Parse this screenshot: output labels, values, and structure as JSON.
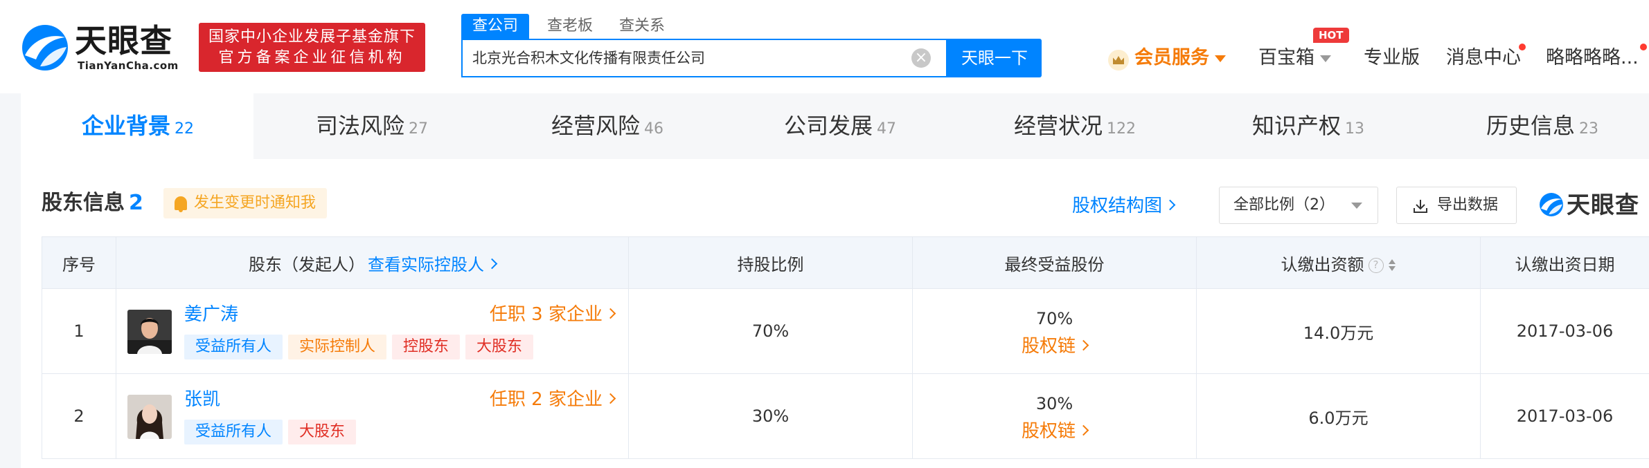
{
  "header": {
    "logo_cn": "天眼查",
    "logo_en": "TianYanCha.com",
    "badge_line1": "国家中小企业发展子基金旗下",
    "badge_line2": "官方备案企业征信机构",
    "search_tabs": [
      "查公司",
      "查老板",
      "查关系"
    ],
    "search_value": "北京光合积木文化传播有限责任公司",
    "search_button": "天眼一下",
    "nav": {
      "vip": "会员服务",
      "toolbox": "百宝箱",
      "hot": "HOT",
      "pro": "专业版",
      "messages": "消息中心",
      "user": "略略略略..."
    }
  },
  "tabs": [
    {
      "label": "企业背景",
      "count": "22"
    },
    {
      "label": "司法风险",
      "count": "27"
    },
    {
      "label": "经营风险",
      "count": "46"
    },
    {
      "label": "公司发展",
      "count": "47"
    },
    {
      "label": "经营状况",
      "count": "122"
    },
    {
      "label": "知识产权",
      "count": "13"
    },
    {
      "label": "历史信息",
      "count": "23"
    }
  ],
  "section": {
    "title": "股东信息",
    "count": "2",
    "notify": "发生变更时通知我",
    "equity_link": "股权结构图",
    "ratio_filter": "全部比例（2）",
    "export": "导出数据",
    "watermark": "天眼查"
  },
  "table": {
    "headers": {
      "index": "序号",
      "shareholder": "股东（发起人）",
      "controller_link": "查看实际控股人",
      "ratio": "持股比例",
      "final_ratio": "最终受益股份",
      "capital": "认缴出资额",
      "date": "认缴出资日期"
    },
    "rows": [
      {
        "index": "1",
        "name": "姜广涛",
        "jobs": "任职 3 家企业",
        "tags": [
          "受益所有人",
          "实际控制人",
          "控股东",
          "大股东"
        ],
        "ratio": "70%",
        "final_ratio": "70%",
        "chain": "股权链",
        "capital": "14.0万元",
        "date": "2017-03-06"
      },
      {
        "index": "2",
        "name": "张凯",
        "jobs": "任职 2 家企业",
        "tags": [
          "受益所有人",
          "大股东"
        ],
        "ratio": "30%",
        "final_ratio": "30%",
        "chain": "股权链",
        "capital": "6.0万元",
        "date": "2017-03-06"
      }
    ]
  },
  "colors": {
    "primary": "#0084ff",
    "orange": "#f57b09",
    "red": "#d9262d"
  }
}
